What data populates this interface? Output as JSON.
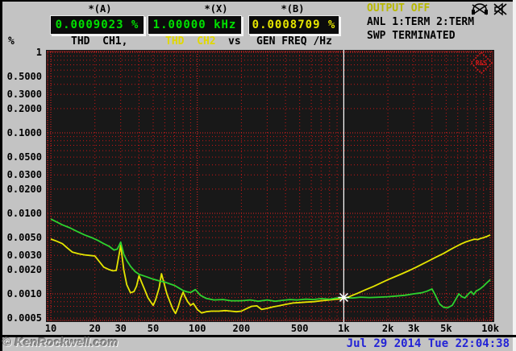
{
  "header": {
    "marker_a": "*(A)",
    "marker_x": "*(X)",
    "marker_b": "*(B)",
    "value_a": "0.0009023 %",
    "value_x": "1.00000 kHz",
    "value_b": "0.0008709 %",
    "output_status": "OUTPUT OFF",
    "analyzer_status": "ANL 1:TERM 2:TERM",
    "sweep_status": "SWP TERMINATED",
    "unit": "%",
    "trace1": "THD  CH1,",
    "trace2": "THD  CH2",
    "vs": "vs",
    "xaxis_label": "GEN FREQ /Hz"
  },
  "logo": {
    "text": "R&S"
  },
  "footer": {
    "watermark": "© KenRockwell.com",
    "timestamp": "Jul 29 2014 Tue 22:04:38"
  },
  "colors": {
    "background": "#c3c3c3",
    "plot_background": "#181818",
    "grid_red": "#c81616",
    "grid_red_bright": "#e62222",
    "trace_ch1_green": "#2ed32e",
    "trace_ch2_yellow": "#e5e500",
    "readout_green": "#00e100",
    "readout_yellow": "#e5e500",
    "output_off_yellow": "#b8b800",
    "cursor_white": "#ffffff",
    "timestamp_blue": "#2323d6",
    "logo_red": "#d81818"
  },
  "chart_data": {
    "type": "line",
    "title": "THD CH1, THD CH2 vs GEN FREQ /Hz",
    "xlabel": "GEN FREQ /Hz",
    "ylabel": "%",
    "x_scale": "log",
    "y_scale": "log",
    "xlim": [
      10,
      10000
    ],
    "ylim": [
      0.0005,
      1
    ],
    "grid": "red dotted, every 1-9 step per decade both axes",
    "legend_position": "none",
    "cursor": {
      "freq_hz": 1000,
      "ch1_percent": 0.0009023,
      "ch2_percent": 0.0008709
    },
    "x_ticks": [
      {
        "label": "10",
        "f": 10
      },
      {
        "label": "20",
        "f": 20
      },
      {
        "label": "30",
        "f": 30
      },
      {
        "label": "50",
        "f": 50
      },
      {
        "label": "100",
        "f": 100
      },
      {
        "label": "200",
        "f": 200
      },
      {
        "label": "500",
        "f": 500
      },
      {
        "label": "1k",
        "f": 1000
      },
      {
        "label": "2k",
        "f": 2000
      },
      {
        "label": "3k",
        "f": 3000
      },
      {
        "label": "5k",
        "f": 5000
      },
      {
        "label": "10k",
        "f": 10000
      }
    ],
    "y_ticks": [
      {
        "label": "1",
        "v": 1
      },
      {
        "label": "0.5000",
        "v": 0.5
      },
      {
        "label": "0.3000",
        "v": 0.3
      },
      {
        "label": "0.2000",
        "v": 0.2
      },
      {
        "label": "0.1000",
        "v": 0.1
      },
      {
        "label": "0.0500",
        "v": 0.05
      },
      {
        "label": "0.0300",
        "v": 0.03
      },
      {
        "label": "0.0200",
        "v": 0.02
      },
      {
        "label": "0.0100",
        "v": 0.01
      },
      {
        "label": "0.0050",
        "v": 0.005
      },
      {
        "label": "0.0030",
        "v": 0.003
      },
      {
        "label": "0.0020",
        "v": 0.002
      },
      {
        "label": "0.0010",
        "v": 0.001
      },
      {
        "label": "0.0005",
        "v": 0.0005
      }
    ],
    "series": [
      {
        "name": "THD CH1",
        "color": "#2ed32e",
        "points": [
          [
            10,
            0.0085
          ],
          [
            11,
            0.0078
          ],
          [
            12,
            0.0072
          ],
          [
            13.5,
            0.0066
          ],
          [
            15,
            0.006
          ],
          [
            17,
            0.0054
          ],
          [
            19,
            0.005
          ],
          [
            21,
            0.0046
          ],
          [
            23,
            0.0042
          ],
          [
            25,
            0.0039
          ],
          [
            27,
            0.0035
          ],
          [
            28.5,
            0.0036
          ],
          [
            30,
            0.0044
          ],
          [
            31.5,
            0.0031
          ],
          [
            33,
            0.0026
          ],
          [
            35,
            0.0022
          ],
          [
            37.5,
            0.0019
          ],
          [
            40,
            0.00175
          ],
          [
            45,
            0.00163
          ],
          [
            50,
            0.00152
          ],
          [
            55,
            0.00145
          ],
          [
            60,
            0.0014
          ],
          [
            65,
            0.00133
          ],
          [
            70,
            0.00127
          ],
          [
            75,
            0.00118
          ],
          [
            80,
            0.0011
          ],
          [
            85,
            0.00106
          ],
          [
            90,
            0.00104
          ],
          [
            97,
            0.00113
          ],
          [
            105,
            0.00096
          ],
          [
            115,
            0.00088
          ],
          [
            130,
            0.00084
          ],
          [
            150,
            0.00085
          ],
          [
            170,
            0.00082
          ],
          [
            200,
            0.00082
          ],
          [
            230,
            0.00084
          ],
          [
            260,
            0.00081
          ],
          [
            300,
            0.00084
          ],
          [
            340,
            0.00081
          ],
          [
            380,
            0.00083
          ],
          [
            430,
            0.00085
          ],
          [
            480,
            0.00084
          ],
          [
            550,
            0.00086
          ],
          [
            620,
            0.00085
          ],
          [
            700,
            0.00087
          ],
          [
            800,
            0.00086
          ],
          [
            900,
            0.00089
          ],
          [
            1000,
            0.0009
          ],
          [
            1150,
            0.00089
          ],
          [
            1300,
            0.00091
          ],
          [
            1500,
            0.0009
          ],
          [
            1750,
            0.00091
          ],
          [
            2000,
            0.00092
          ],
          [
            2300,
            0.00094
          ],
          [
            2600,
            0.00096
          ],
          [
            3000,
            0.001
          ],
          [
            3400,
            0.00103
          ],
          [
            3700,
            0.00108
          ],
          [
            4000,
            0.00115
          ],
          [
            4200,
            0.00098
          ],
          [
            4500,
            0.00075
          ],
          [
            4800,
            0.00068
          ],
          [
            5100,
            0.00067
          ],
          [
            5500,
            0.00072
          ],
          [
            5800,
            0.00085
          ],
          [
            6100,
            0.001
          ],
          [
            6400,
            0.00092
          ],
          [
            6700,
            0.00089
          ],
          [
            7100,
            0.001
          ],
          [
            7400,
            0.00107
          ],
          [
            7700,
            0.00098
          ],
          [
            8000,
            0.00108
          ],
          [
            8500,
            0.00115
          ],
          [
            9000,
            0.00125
          ],
          [
            9500,
            0.00138
          ],
          [
            10000,
            0.0015
          ]
        ]
      },
      {
        "name": "THD CH2",
        "color": "#e5e500",
        "points": [
          [
            10,
            0.0048
          ],
          [
            11,
            0.0045
          ],
          [
            12,
            0.0042
          ],
          [
            13,
            0.0037
          ],
          [
            14,
            0.0033
          ],
          [
            15.5,
            0.00315
          ],
          [
            17,
            0.00305
          ],
          [
            18.5,
            0.003
          ],
          [
            20,
            0.00295
          ],
          [
            21.5,
            0.0025
          ],
          [
            23,
            0.00215
          ],
          [
            25,
            0.002
          ],
          [
            26.5,
            0.00193
          ],
          [
            28,
            0.00195
          ],
          [
            30,
            0.004
          ],
          [
            31.5,
            0.002
          ],
          [
            33,
            0.0013
          ],
          [
            35,
            0.00103
          ],
          [
            37,
            0.00107
          ],
          [
            38.5,
            0.00125
          ],
          [
            40,
            0.00168
          ],
          [
            42,
            0.00135
          ],
          [
            44,
            0.0011
          ],
          [
            46,
            0.0009
          ],
          [
            48,
            0.0008
          ],
          [
            50,
            0.00072
          ],
          [
            52,
            0.00085
          ],
          [
            55,
            0.0012
          ],
          [
            57,
            0.00178
          ],
          [
            59,
            0.0014
          ],
          [
            62,
            0.001
          ],
          [
            65,
            0.0008
          ],
          [
            68,
            0.00065
          ],
          [
            71,
            0.00057
          ],
          [
            74,
            0.00068
          ],
          [
            77,
            0.00088
          ],
          [
            80,
            0.00105
          ],
          [
            83,
            0.0009
          ],
          [
            86,
            0.0008
          ],
          [
            90,
            0.00072
          ],
          [
            94,
            0.00076
          ],
          [
            100,
            0.00064
          ],
          [
            107,
            0.00058
          ],
          [
            115,
            0.0006
          ],
          [
            125,
            0.00061
          ],
          [
            140,
            0.00061
          ],
          [
            155,
            0.00062
          ],
          [
            170,
            0.00061
          ],
          [
            185,
            0.0006
          ],
          [
            200,
            0.00061
          ],
          [
            215,
            0.00065
          ],
          [
            235,
            0.0007
          ],
          [
            255,
            0.00071
          ],
          [
            275,
            0.00064
          ],
          [
            300,
            0.00066
          ],
          [
            330,
            0.00069
          ],
          [
            360,
            0.00071
          ],
          [
            400,
            0.00074
          ],
          [
            450,
            0.00077
          ],
          [
            500,
            0.00078
          ],
          [
            560,
            0.00079
          ],
          [
            630,
            0.0008
          ],
          [
            700,
            0.00082
          ],
          [
            800,
            0.00084
          ],
          [
            900,
            0.00086
          ],
          [
            1000,
            0.00087
          ],
          [
            1100,
            0.00093
          ],
          [
            1250,
            0.00102
          ],
          [
            1400,
            0.00112
          ],
          [
            1600,
            0.00124
          ],
          [
            1800,
            0.00137
          ],
          [
            2000,
            0.0015
          ],
          [
            2250,
            0.00164
          ],
          [
            2500,
            0.00178
          ],
          [
            2800,
            0.00195
          ],
          [
            3100,
            0.00213
          ],
          [
            3500,
            0.00238
          ],
          [
            3900,
            0.00263
          ],
          [
            4300,
            0.00288
          ],
          [
            4800,
            0.00318
          ],
          [
            5300,
            0.00352
          ],
          [
            5800,
            0.00385
          ],
          [
            6300,
            0.00415
          ],
          [
            6800,
            0.00442
          ],
          [
            7300,
            0.0046
          ],
          [
            7800,
            0.00477
          ],
          [
            8200,
            0.00472
          ],
          [
            8600,
            0.00487
          ],
          [
            9000,
            0.005
          ],
          [
            9500,
            0.00518
          ],
          [
            10000,
            0.0054
          ]
        ]
      }
    ]
  }
}
